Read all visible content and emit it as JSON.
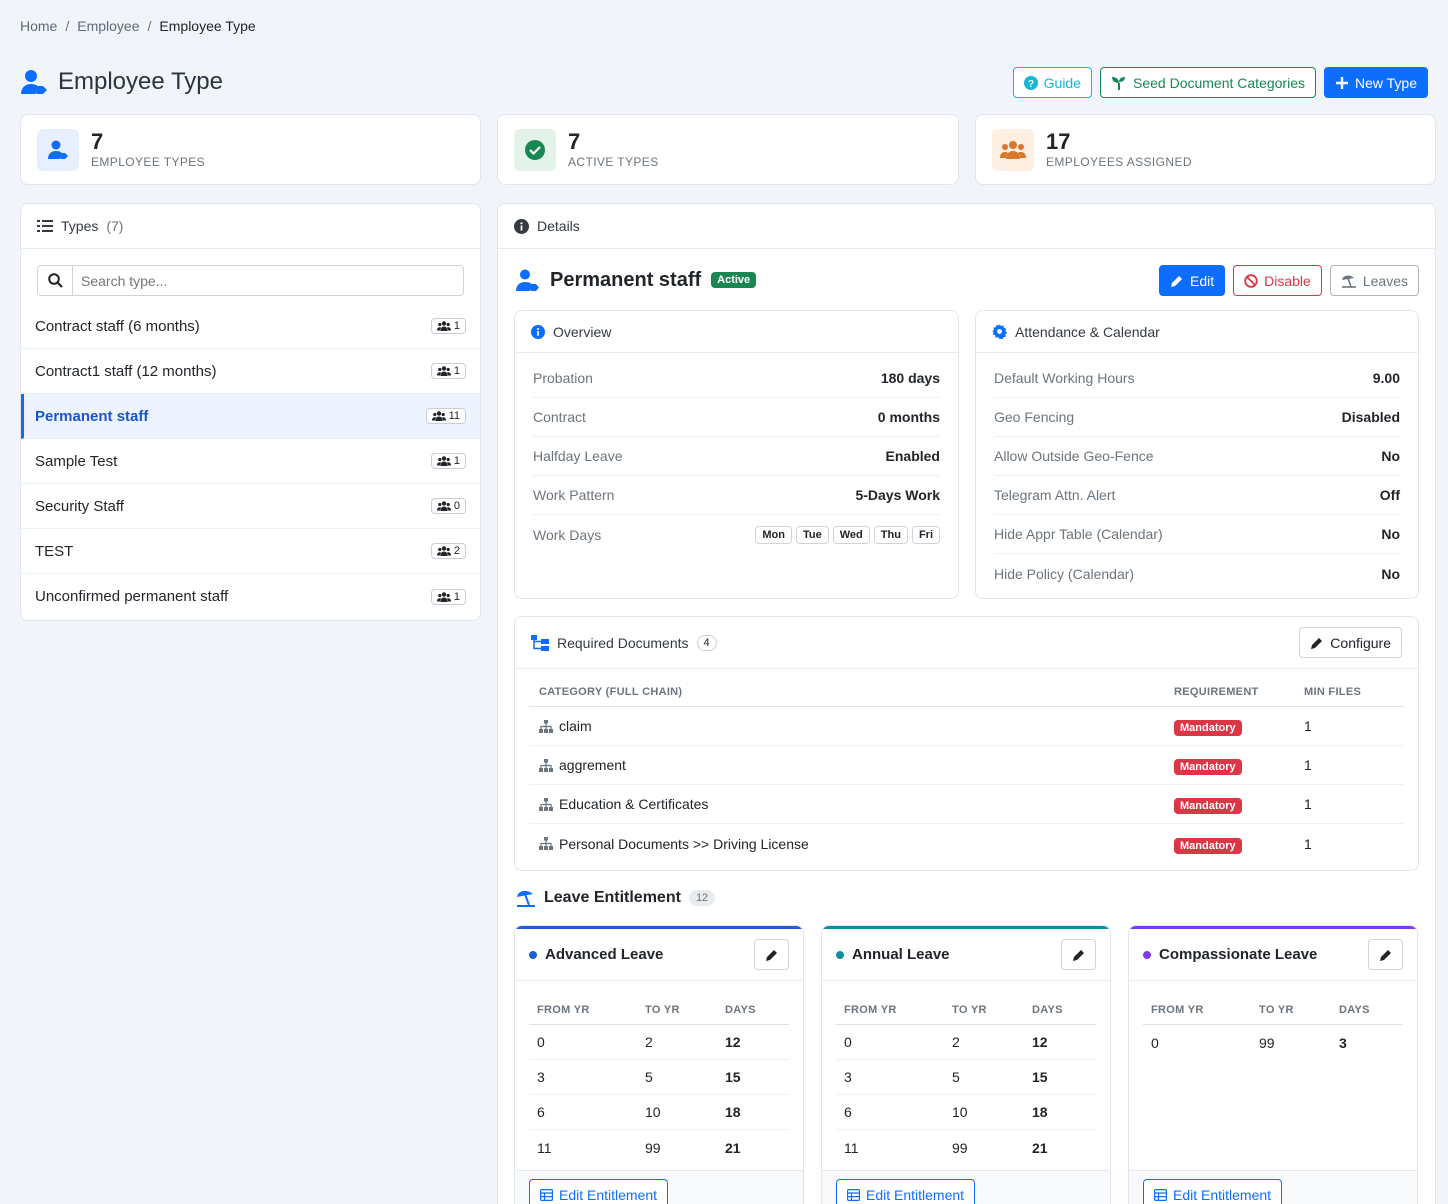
{
  "breadcrumb": {
    "home": "Home",
    "employee": "Employee",
    "current": "Employee Type"
  },
  "page": {
    "title": "Employee Type"
  },
  "actions": {
    "guide": "Guide",
    "seed": "Seed Document Categories",
    "new_type": "New Type"
  },
  "stats": [
    {
      "value": "7",
      "label": "EMPLOYEE TYPES"
    },
    {
      "value": "7",
      "label": "ACTIVE TYPES"
    },
    {
      "value": "17",
      "label": "EMPLOYEES ASSIGNED"
    }
  ],
  "types_panel": {
    "title": "Types",
    "count": "(7)",
    "search_placeholder": "Search type...",
    "items": [
      {
        "name": "Contract staff (6 months)",
        "count": "1"
      },
      {
        "name": "Contract1 staff (12 months)",
        "count": "1"
      },
      {
        "name": "Permanent staff",
        "count": "11"
      },
      {
        "name": "Sample Test",
        "count": "1"
      },
      {
        "name": "Security Staff",
        "count": "0"
      },
      {
        "name": "TEST",
        "count": "2"
      },
      {
        "name": "Unconfirmed permanent staff",
        "count": "1"
      }
    ]
  },
  "details": {
    "header": "Details",
    "name": "Permanent staff",
    "status": "Active",
    "edit": "Edit",
    "disable": "Disable",
    "leaves": "Leaves",
    "overview": {
      "title": "Overview",
      "rows": [
        {
          "label": "Probation",
          "value": "180 days"
        },
        {
          "label": "Contract",
          "value": "0 months"
        },
        {
          "label": "Halfday Leave",
          "value": "Enabled"
        },
        {
          "label": "Work Pattern",
          "value": "5-Days Work"
        }
      ],
      "work_days_label": "Work Days",
      "work_days": [
        "Mon",
        "Tue",
        "Wed",
        "Thu",
        "Fri"
      ]
    },
    "attendance": {
      "title": "Attendance & Calendar",
      "rows": [
        {
          "label": "Default Working Hours",
          "value": "9.00"
        },
        {
          "label": "Geo Fencing",
          "value": "Disabled"
        },
        {
          "label": "Allow Outside Geo-Fence",
          "value": "No"
        },
        {
          "label": "Telegram Attn. Alert",
          "value": "Off"
        },
        {
          "label": "Hide Appr Table (Calendar)",
          "value": "No"
        },
        {
          "label": "Hide Policy (Calendar)",
          "value": "No"
        }
      ]
    },
    "documents": {
      "title": "Required Documents",
      "count": "4",
      "configure": "Configure",
      "headers": [
        "CATEGORY (FULL CHAIN)",
        "REQUIREMENT",
        "MIN FILES"
      ],
      "rows": [
        {
          "category": "claim",
          "requirement": "Mandatory",
          "min": "1"
        },
        {
          "category": "aggrement",
          "requirement": "Mandatory",
          "min": "1"
        },
        {
          "category": "Education & Certificates",
          "requirement": "Mandatory",
          "min": "1"
        },
        {
          "category": "Personal Documents >> Driving License",
          "requirement": "Mandatory",
          "min": "1"
        }
      ]
    },
    "leave": {
      "title": "Leave Entitlement",
      "count": "12",
      "headers": [
        "FROM YR",
        "TO YR",
        "DAYS"
      ],
      "edit_label": "Edit Entitlement",
      "cards": [
        {
          "name": "Advanced Leave",
          "color": "#1f5fd6",
          "rows": [
            [
              "0",
              "2",
              "12"
            ],
            [
              "3",
              "5",
              "15"
            ],
            [
              "6",
              "10",
              "18"
            ],
            [
              "11",
              "99",
              "21"
            ]
          ]
        },
        {
          "name": "Annual Leave",
          "color": "#0f8ea0",
          "rows": [
            [
              "0",
              "2",
              "12"
            ],
            [
              "3",
              "5",
              "15"
            ],
            [
              "6",
              "10",
              "18"
            ],
            [
              "11",
              "99",
              "21"
            ]
          ]
        },
        {
          "name": "Compassionate Leave",
          "color": "#7c3aed",
          "rows": [
            [
              "0",
              "99",
              "3"
            ]
          ]
        }
      ]
    }
  },
  "colors": {
    "primary": "#0d6efd",
    "success": "#198754",
    "danger": "#dc3545",
    "info": "#17b6d3"
  }
}
